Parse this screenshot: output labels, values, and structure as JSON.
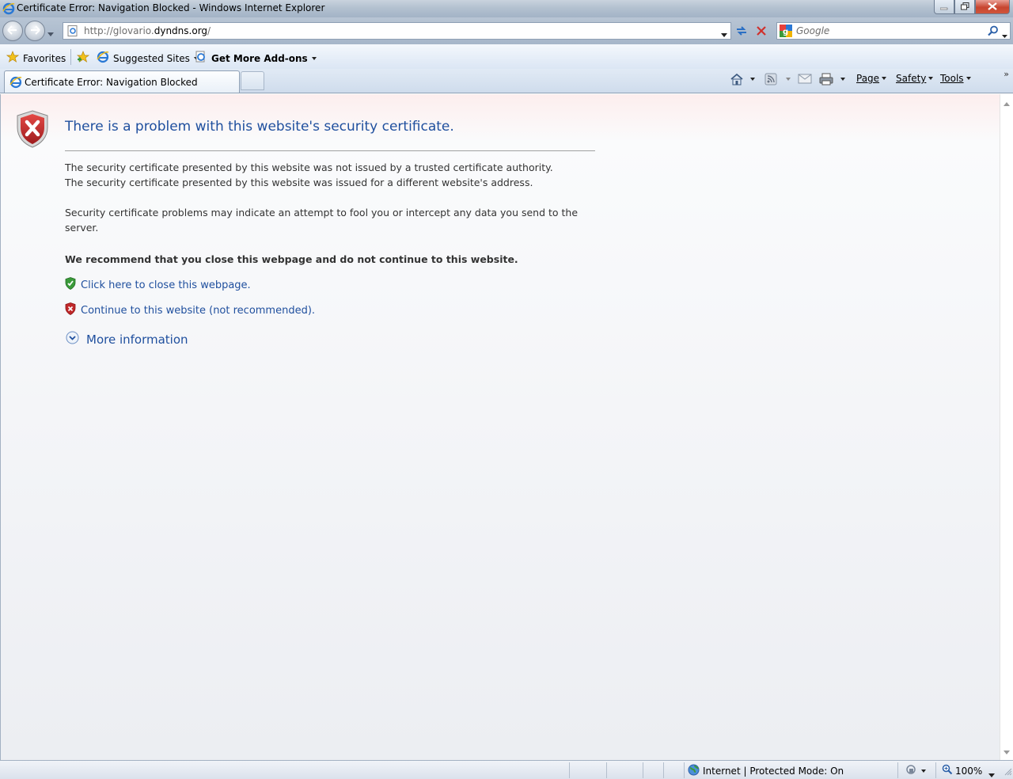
{
  "window": {
    "title": "Certificate Error: Navigation Blocked - Windows Internet Explorer"
  },
  "address": {
    "url_prefix": "http://glovario.",
    "url_domain": "dyndns.org",
    "url_suffix": "/"
  },
  "search": {
    "placeholder": "Google"
  },
  "favorites": {
    "favorites_label": "Favorites",
    "suggested_label": "Suggested Sites",
    "addons_label": "Get More Add-ons"
  },
  "tabs": [
    {
      "label": "Certificate Error: Navigation Blocked"
    }
  ],
  "commandbar": {
    "page_label": "Page",
    "safety_label": "Safety",
    "tools_label": "Tools"
  },
  "content": {
    "title": "There is a problem with this website's security certificate.",
    "line1": "The security certificate presented by this website was not issued by a trusted certificate authority.",
    "line2": "The security certificate presented by this website was issued for a different website's address.",
    "line3": "Security certificate problems may indicate an attempt to fool you or intercept any data you send to the",
    "line4": "server.",
    "recommend": "We recommend that you close this webpage and do not continue to this website.",
    "close_link": "Click here to close this webpage.",
    "continue_link": "Continue to this website (not recommended).",
    "more_info": "More information"
  },
  "status": {
    "zone": "Internet | Protected Mode: On",
    "zoom": "100%"
  },
  "colors": {
    "link": "#1f4f9e",
    "shield_red": "#c0282a",
    "shield_green": "#3a9a3a"
  }
}
